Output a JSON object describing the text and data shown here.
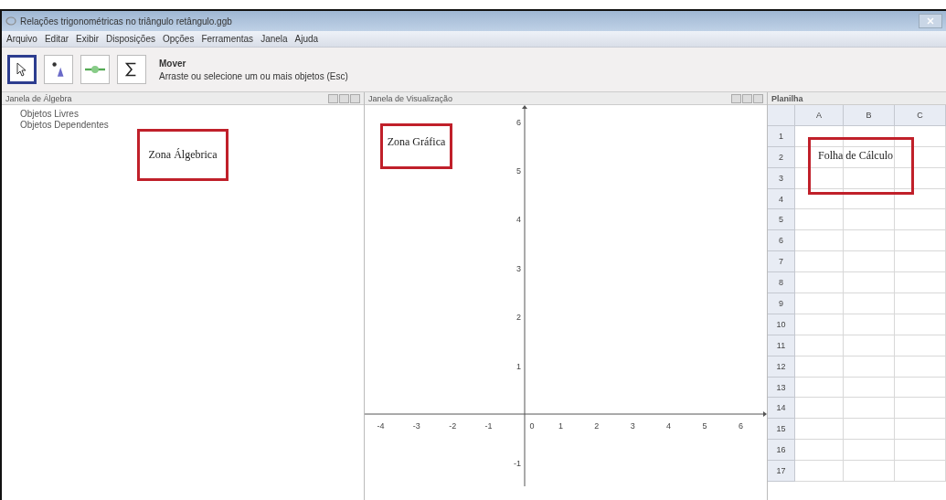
{
  "window": {
    "title": "Relações trigonométricas no triângulo retângulo.ggb"
  },
  "menu": [
    "Arquivo",
    "Editar",
    "Exibir",
    "Disposições",
    "Opções",
    "Ferramentas",
    "Janela",
    "Ajuda"
  ],
  "toolbar": {
    "tools": [
      {
        "kind": "move",
        "selected": true
      },
      {
        "kind": "point",
        "selected": false
      },
      {
        "kind": "slider",
        "selected": false
      },
      {
        "kind": "sum",
        "selected": false
      }
    ],
    "tool_name": "Mover",
    "tool_hint": "Arraste ou selecione um ou mais objetos (Esc)"
  },
  "algebra": {
    "title": "Janela de Álgebra",
    "items": [
      "Objetos Livres",
      "Objetos Dependentes"
    ],
    "annotation": "Zona Álgebrica"
  },
  "graphics": {
    "title": "Janela de Visualização",
    "annotation": "Zona Gráfica",
    "x_ticks": [
      "-4",
      "-3",
      "-2",
      "-1",
      "0",
      "1",
      "2",
      "3",
      "4",
      "5",
      "6"
    ],
    "y_ticks": [
      "6",
      "5",
      "4",
      "3",
      "2",
      "1",
      "-1"
    ]
  },
  "spreadsheet": {
    "title": "Planilha",
    "columns": [
      "A",
      "B",
      "C"
    ],
    "rows": [
      "1",
      "2",
      "3",
      "4",
      "5",
      "6",
      "7",
      "8",
      "9",
      "10",
      "11",
      "12",
      "13",
      "14",
      "15",
      "16",
      "17"
    ],
    "annotation": "Folha de Cálculo"
  }
}
